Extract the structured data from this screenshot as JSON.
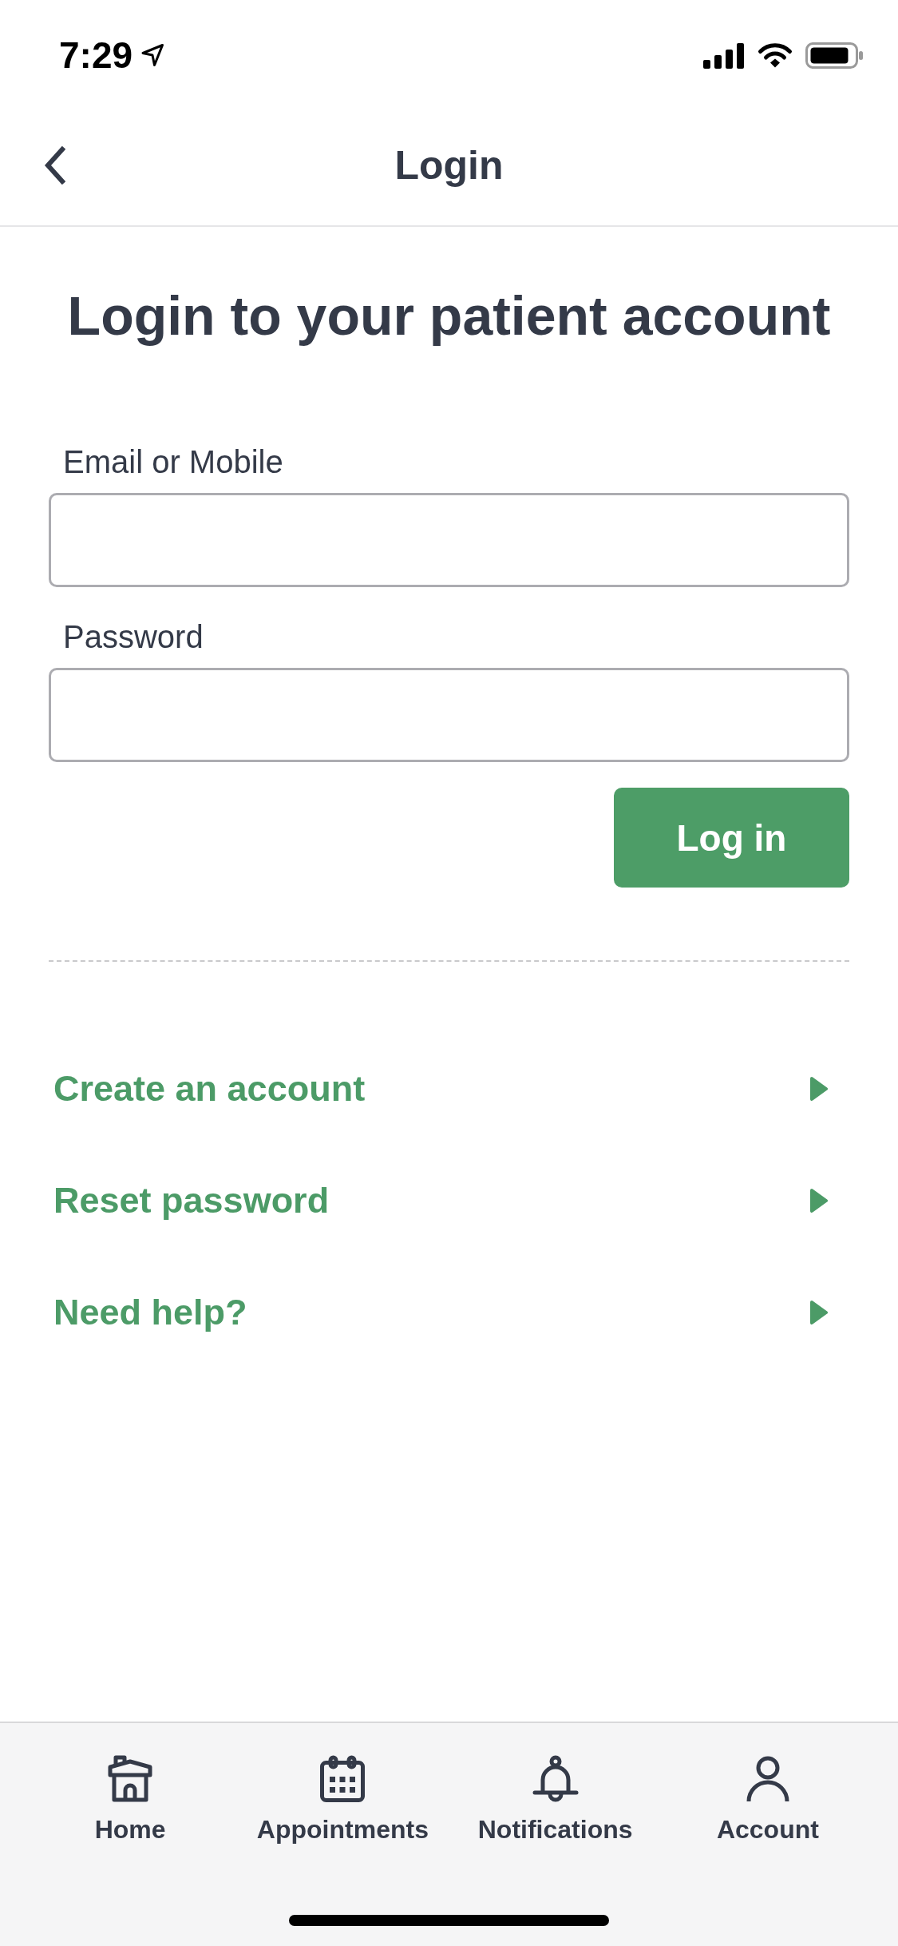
{
  "status_bar": {
    "time": "7:29"
  },
  "nav_bar": {
    "title": "Login"
  },
  "heading": "Login to your patient account",
  "form": {
    "fields": [
      {
        "label": "Email or Mobile"
      },
      {
        "label": "Password"
      }
    ],
    "submit": "Log in"
  },
  "links": [
    {
      "label": "Create an account"
    },
    {
      "label": "Reset password"
    },
    {
      "label": "Need help?"
    }
  ],
  "tab_bar": {
    "tabs": [
      {
        "label": "Home"
      },
      {
        "label": "Appointments"
      },
      {
        "label": "Notifications"
      },
      {
        "label": "Account"
      }
    ]
  }
}
